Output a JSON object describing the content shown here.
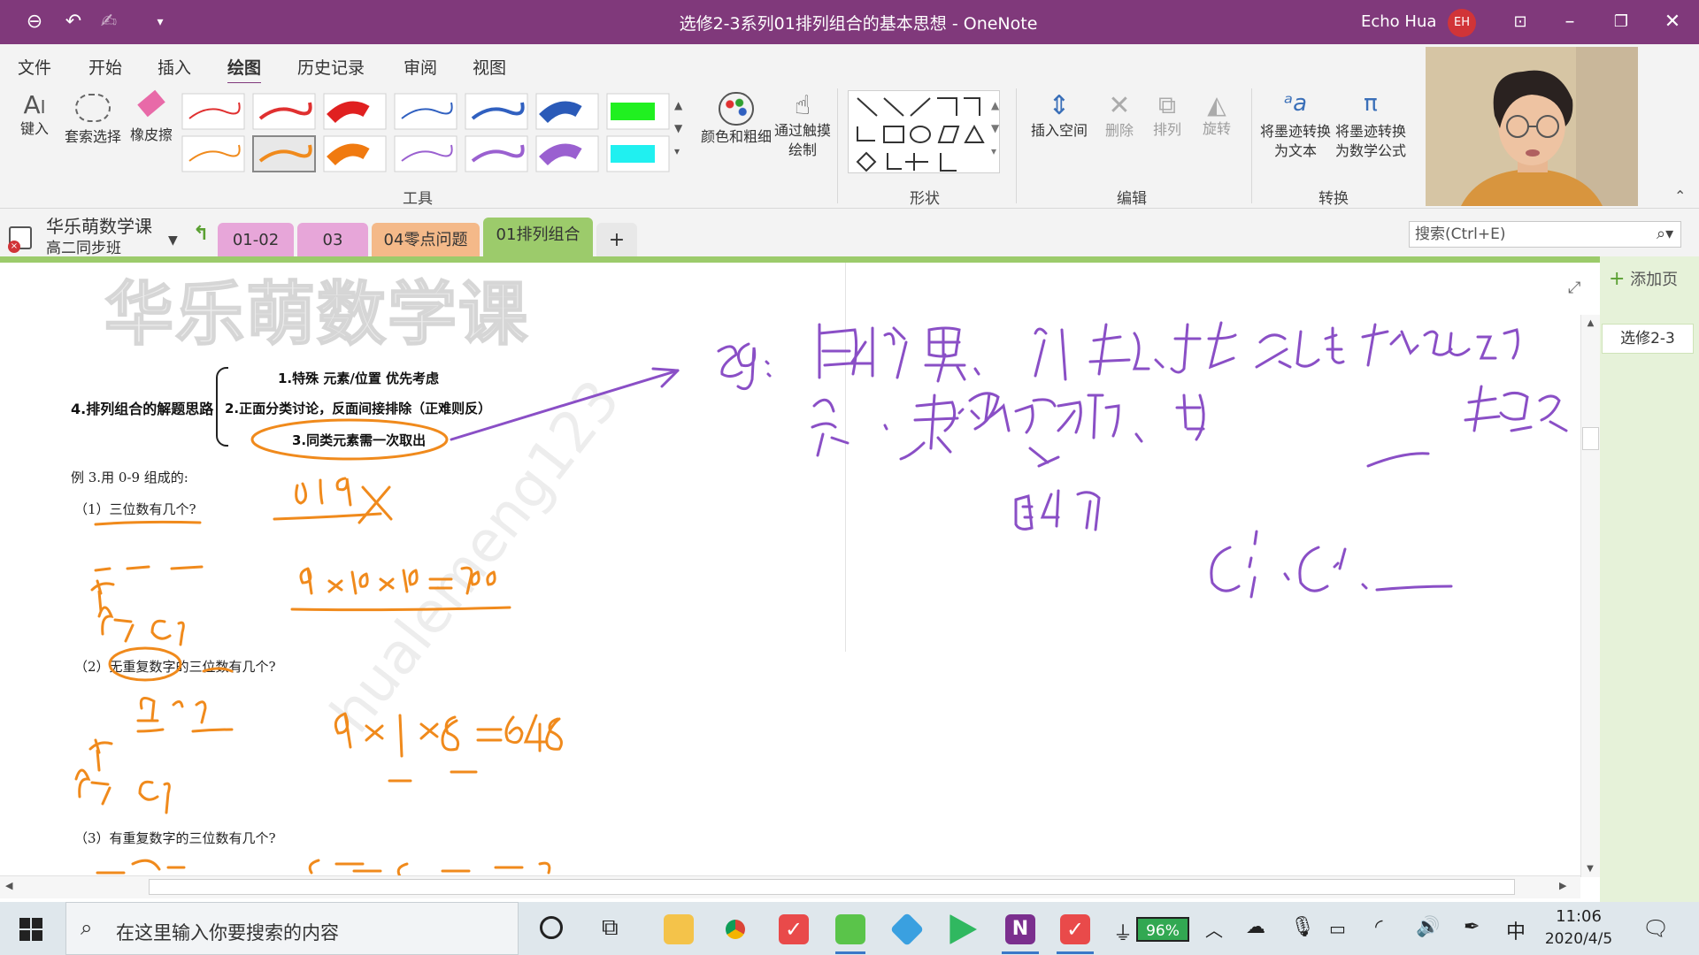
{
  "window": {
    "title": "选修2-3系列01排列组合的基本思想 - OneNote",
    "user_name": "Echo Hua",
    "user_initials": "EH"
  },
  "menu": {
    "tabs": [
      "文件",
      "开始",
      "插入",
      "绘图",
      "历史记录",
      "审阅",
      "视图"
    ]
  },
  "ribbon": {
    "type_label": "键入",
    "lasso_label": "套索选择",
    "eraser_label": "橡皮擦",
    "color_thickness_label": "颜色和粗细",
    "touch_draw_label": "通过触摸绘制",
    "insert_space_label": "插入空间",
    "delete_label": "删除",
    "arrange_label": "排列",
    "rotate_label": "旋转",
    "ink_to_text_label": "将墨迹转换为文本",
    "ink_to_math_label": "将墨迹转换为数学公式",
    "groups": {
      "tools": "工具",
      "shapes": "形状",
      "edit": "编辑",
      "convert": "转换"
    }
  },
  "notebook": {
    "name": "华乐萌数学课",
    "section_group": "高二同步班",
    "sections": [
      "01-02",
      "03",
      "04零点问题",
      "01排列组合"
    ],
    "add_tab": "+"
  },
  "search": {
    "placeholder": "搜索(Ctrl+E)"
  },
  "pages_pane": {
    "add_page": "添加页",
    "pages": [
      "选修2-3"
    ]
  },
  "content": {
    "watermark_title": "华乐萌数学课",
    "diagram_title": "4.排列组合的解题思路",
    "diagram_items": [
      "1.特殊 元素/位置 优先考虑",
      "2.正面分类讨论，反面间接排除（正难则反）",
      "3.同类元素需一次取出"
    ],
    "example_title": "例 3.用 0-9 组成的:",
    "q1": "（1）三位数有几个?",
    "q2": "（2）无重复数字的三位数有几个?",
    "q3": "（3）有重复数字的三位数有几个?",
    "faint_watermark": "hualemeng123"
  },
  "taskbar": {
    "search_placeholder": "在这里输入你要搜索的内容",
    "battery": "96%",
    "ime": "中",
    "time": "11:06",
    "date": "2020/4/5"
  },
  "colors": {
    "title_bar": "#80397b",
    "ink_orange": "#f08a1c",
    "ink_purple": "#8a4fc6",
    "section_active": "#9ccb6b"
  }
}
